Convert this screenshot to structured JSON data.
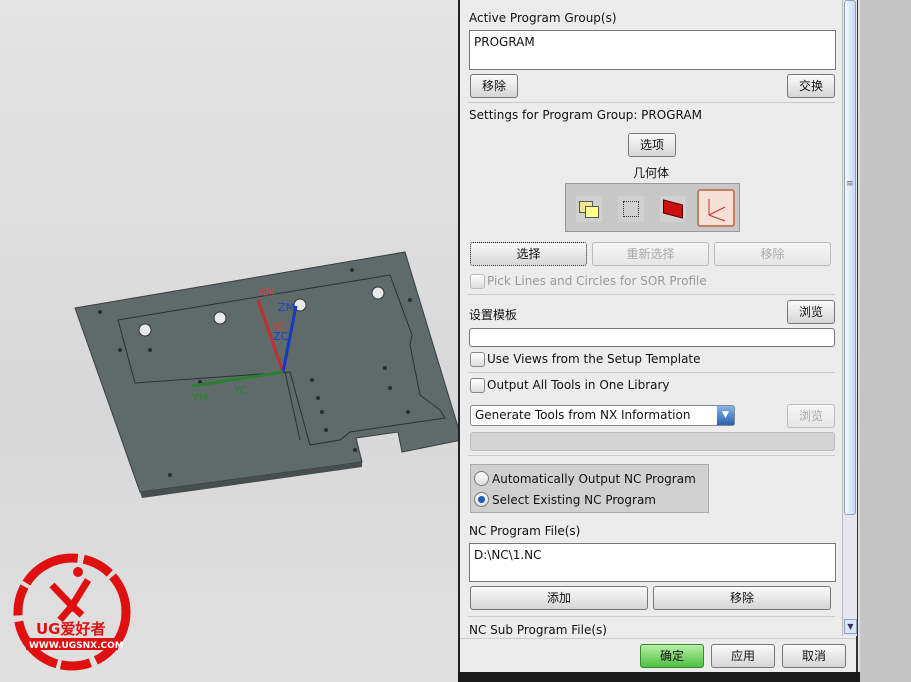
{
  "viewport": {
    "axes": {
      "xm": "XM",
      "xc": "XC",
      "zm": "ZM",
      "zc": "ZC",
      "ym": "YM",
      "yc": "YC"
    },
    "logo": {
      "brand": "UG爱好者",
      "url": "WWW.UGSNX.COM"
    }
  },
  "dialog": {
    "active_group_label": "Active Program Group(s)",
    "active_group_value": "PROGRAM",
    "remove_label": "移除",
    "swap_label": "交换",
    "settings_label": "Settings for Program Group: PROGRAM",
    "options_label": "选项",
    "geometry_label": "几何体",
    "geometry_icons": [
      "part-geometry-icon",
      "blank-geometry-icon",
      "solid-body-icon",
      "mcs-icon"
    ],
    "select_label": "选择",
    "reselect_label": "重新选择",
    "remove2_label": "移除",
    "pick_lines_label": "Pick Lines and Circles for SOR Profile",
    "template_label": "设置模板",
    "browse_label": "浏览",
    "template_value": "",
    "use_views_label": "Use Views from the Setup Template",
    "output_tools_label": "Output All Tools in One Library",
    "tools_dropdown": "Generate Tools from NX Information",
    "browse2_label": "浏览",
    "radio_auto": "Automatically Output NC Program",
    "radio_select": "Select Existing NC Program",
    "radio_selected": "Select Existing NC Program",
    "nc_file_label": "NC Program File(s)",
    "nc_file_value": "D:\\NC\\1.NC",
    "add_label": "添加",
    "remove3_label": "移除",
    "nc_sub_label": "NC Sub Program File(s)",
    "ok_label": "确定",
    "apply_label": "应用",
    "cancel_label": "取消"
  }
}
